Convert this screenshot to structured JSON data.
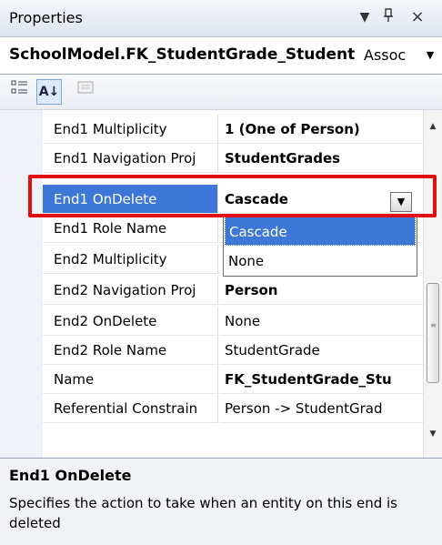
{
  "titlebar": {
    "title": "Properties",
    "dropdown_icon": "▼",
    "pin_icon": "ᵖ",
    "close_icon": "×"
  },
  "object_selector": {
    "name": "SchoolModel.FK_StudentGrade_Student",
    "type": "Assoc",
    "arrow": "▼"
  },
  "toolbar": {
    "categorized_icon": "categorized-icon",
    "alphabetical_icon": "alphabetical-icon",
    "alphabetical_glyph": "A↓",
    "property_pages_icon": "property-pages-icon"
  },
  "grid": {
    "rows": [
      {
        "name": "End1 Multiplicity",
        "value": "1 (One of Person)"
      },
      {
        "name": "End1 Navigation Proj",
        "value": "StudentGrades"
      },
      {
        "name": "End1 OnDelete",
        "value": "Cascade"
      },
      {
        "name": "End1 Role Name",
        "value": ""
      },
      {
        "name": "End2 Multiplicity",
        "value": ""
      },
      {
        "name": "End2 Navigation Proj",
        "value": "Person"
      },
      {
        "name": "End2 OnDelete",
        "value": "None"
      },
      {
        "name": "End2 Role Name",
        "value": "StudentGrade"
      },
      {
        "name": "Name",
        "value": "FK_StudentGrade_Stu"
      },
      {
        "name": "Referential Constrain",
        "value": "Person -> StudentGrad"
      }
    ],
    "dropdown_arrow": "▼"
  },
  "dropdown": {
    "options": [
      "Cascade",
      "None"
    ],
    "selected": "Cascade"
  },
  "description": {
    "title": "End1 OnDelete",
    "text": "Specifies the action to take when an entity on this end is deleted"
  },
  "colors": {
    "selection": "#3d77d7",
    "highlight_box": "#e01010"
  }
}
